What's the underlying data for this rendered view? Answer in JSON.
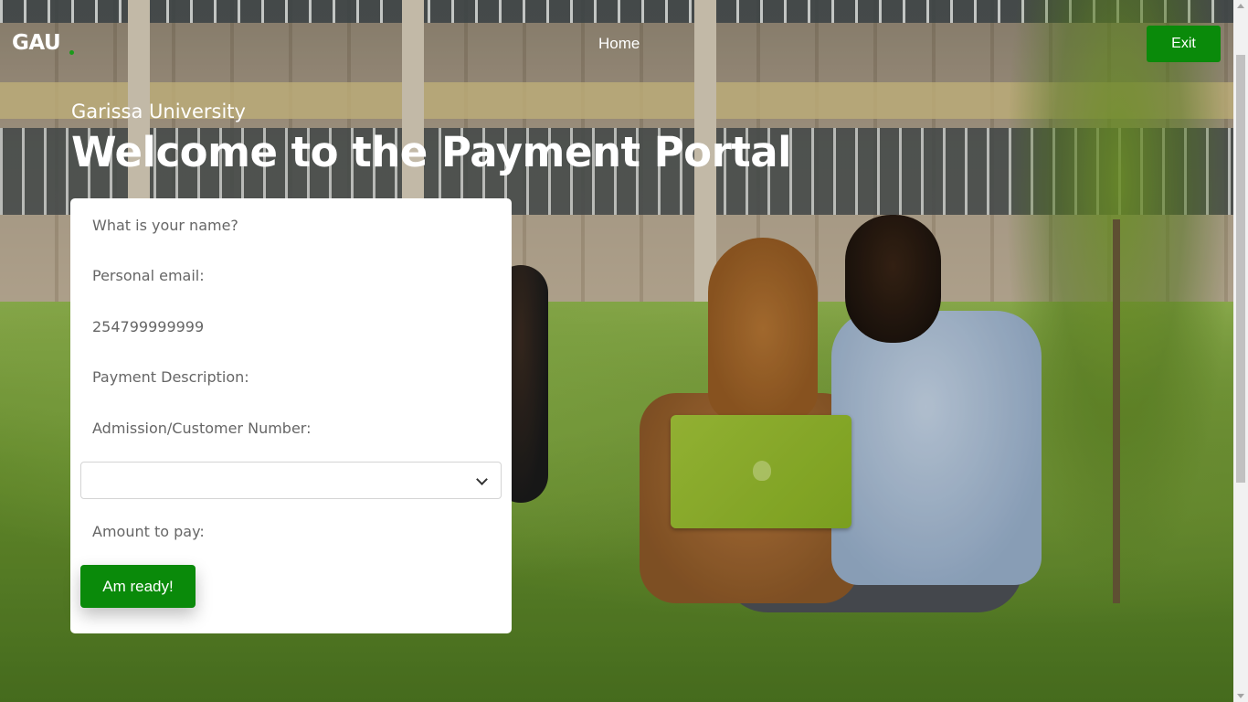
{
  "nav": {
    "brand": "GAU",
    "home_label": "Home",
    "exit_label": "Exit"
  },
  "hero": {
    "subtitle": "Garissa University",
    "title": "Welcome to the Payment Portal"
  },
  "form": {
    "name_placeholder": "What is your name?",
    "email_placeholder": "Personal email:",
    "phone_placeholder": "254799999999",
    "description_placeholder": "Payment Description:",
    "admission_placeholder": "Admission/Customer Number:",
    "select_value": "",
    "amount_placeholder": "Amount to pay:",
    "submit_label": "Am ready!"
  },
  "colors": {
    "accent_green": "#0a8a0a",
    "card_bg": "#ffffff",
    "text_white": "#ffffff"
  },
  "icons": {
    "select_arrow": "chevron-down-icon",
    "scroll_up": "scroll-up-arrow",
    "scroll_down": "scroll-down-arrow"
  }
}
